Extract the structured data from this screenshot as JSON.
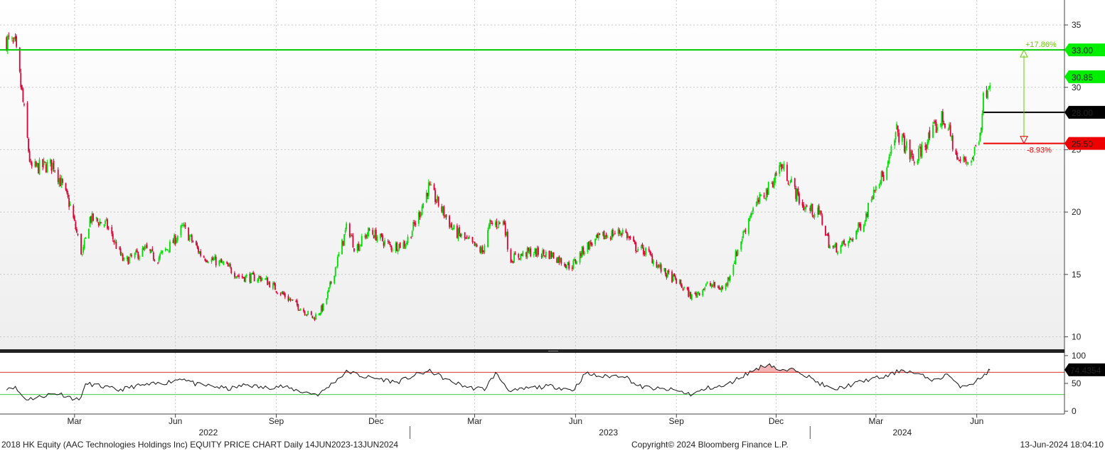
{
  "chart_data": [
    {
      "type": "candlestick",
      "ylim": [
        9,
        37
      ],
      "yticks": [
        10,
        15,
        20,
        25,
        30,
        35
      ],
      "grid": true,
      "up_color": "#00dd00",
      "down_color": "#dd0033",
      "price_path": [
        [
          "2021-12-29",
          33.8
        ],
        [
          "2022-01-06",
          33.2
        ],
        [
          "2022-01-12",
          29.5
        ],
        [
          "2022-01-20",
          23.5
        ],
        [
          "2022-02-10",
          23.8
        ],
        [
          "2022-02-25",
          20.5
        ],
        [
          "2022-03-08",
          16.5
        ],
        [
          "2022-03-15",
          19.5
        ],
        [
          "2022-03-30",
          19.0
        ],
        [
          "2022-04-15",
          16.0
        ],
        [
          "2022-05-05",
          17.0
        ],
        [
          "2022-05-15",
          16.2
        ],
        [
          "2022-05-30",
          17.6
        ],
        [
          "2022-06-08",
          18.8
        ],
        [
          "2022-06-25",
          16.5
        ],
        [
          "2022-07-15",
          15.8
        ],
        [
          "2022-07-30",
          14.8
        ],
        [
          "2022-08-20",
          14.7
        ],
        [
          "2022-09-10",
          13.2
        ],
        [
          "2022-10-05",
          11.5
        ],
        [
          "2022-10-15",
          12.5
        ],
        [
          "2022-10-28",
          16.5
        ],
        [
          "2022-11-05",
          19.0
        ],
        [
          "2022-11-12",
          17.0
        ],
        [
          "2022-11-25",
          18.5
        ],
        [
          "2022-12-15",
          17.2
        ],
        [
          "2022-12-28",
          17.5
        ],
        [
          "2023-01-08",
          19.5
        ],
        [
          "2023-01-18",
          22.0
        ],
        [
          "2023-01-28",
          20.5
        ],
        [
          "2023-02-10",
          18.5
        ],
        [
          "2023-02-25",
          17.5
        ],
        [
          "2023-03-08",
          16.8
        ],
        [
          "2023-03-15",
          19.0
        ],
        [
          "2023-03-28",
          19.2
        ],
        [
          "2023-04-02",
          16.2
        ],
        [
          "2023-04-20",
          16.8
        ],
        [
          "2023-05-10",
          16.6
        ],
        [
          "2023-05-28",
          15.6
        ],
        [
          "2023-06-10",
          17.2
        ],
        [
          "2023-06-25",
          18.0
        ],
        [
          "2023-07-15",
          18.5
        ],
        [
          "2023-07-25",
          17.2
        ],
        [
          "2023-08-05",
          16.8
        ],
        [
          "2023-08-20",
          15.2
        ],
        [
          "2023-09-01",
          14.5
        ],
        [
          "2023-09-15",
          13.2
        ],
        [
          "2023-09-30",
          14.2
        ],
        [
          "2023-10-15",
          13.8
        ],
        [
          "2023-10-25",
          16.5
        ],
        [
          "2023-11-08",
          20.0
        ],
        [
          "2023-11-25",
          22.0
        ],
        [
          "2023-12-05",
          23.8
        ],
        [
          "2023-12-12",
          22.8
        ],
        [
          "2023-12-25",
          20.5
        ],
        [
          "2024-01-10",
          19.8
        ],
        [
          "2024-01-20",
          17.0
        ],
        [
          "2024-02-05",
          17.5
        ],
        [
          "2024-02-20",
          19.5
        ],
        [
          "2024-03-01",
          22.5
        ],
        [
          "2024-03-10",
          23.0
        ],
        [
          "2024-03-20",
          26.5
        ],
        [
          "2024-04-05",
          24.0
        ],
        [
          "2024-04-15",
          25.5
        ],
        [
          "2024-04-30",
          27.5
        ],
        [
          "2024-05-05",
          27.0
        ],
        [
          "2024-05-15",
          24.0
        ],
        [
          "2024-05-28",
          24.3
        ],
        [
          "2024-06-04",
          26.5
        ],
        [
          "2024-06-07",
          29.0
        ],
        [
          "2024-06-13",
          30.85
        ]
      ],
      "hlines": [
        {
          "label": "33.00",
          "value": 33.0,
          "color": "#00cc00",
          "from": "start"
        },
        {
          "label": "28.00",
          "value": 28.0,
          "color": "#000000",
          "from": "2024-06-07"
        },
        {
          "label": "25.50",
          "value": 25.5,
          "color": "#ee0000",
          "from": "2024-06-07"
        }
      ],
      "last_price": {
        "label": "30.85",
        "value": 30.85,
        "color": "#00ee00"
      },
      "annotations": [
        {
          "text": "+17.86%",
          "color": "#66cc00",
          "value": 33.0
        },
        {
          "text": "-8.93%",
          "color": "#ee0000",
          "value": 25.5
        }
      ]
    },
    {
      "type": "line",
      "ylim": [
        -5,
        105
      ],
      "yticks": [
        0,
        50,
        100
      ],
      "levels": [
        70,
        30
      ],
      "last_value": {
        "label": "74.4354",
        "value": 74.4354
      },
      "path": [
        [
          "2021-12-29",
          42
        ],
        [
          "2022-01-05",
          44
        ],
        [
          "2022-01-15",
          22
        ],
        [
          "2022-01-25",
          24
        ],
        [
          "2022-02-05",
          30
        ],
        [
          "2022-02-15",
          32
        ],
        [
          "2022-02-25",
          25
        ],
        [
          "2022-03-05",
          20
        ],
        [
          "2022-03-12",
          50
        ],
        [
          "2022-03-25",
          45
        ],
        [
          "2022-04-10",
          38
        ],
        [
          "2022-04-25",
          45
        ],
        [
          "2022-05-10",
          48
        ],
        [
          "2022-05-25",
          52
        ],
        [
          "2022-06-08",
          60
        ],
        [
          "2022-06-20",
          48
        ],
        [
          "2022-07-05",
          45
        ],
        [
          "2022-07-20",
          40
        ],
        [
          "2022-08-05",
          48
        ],
        [
          "2022-08-20",
          42
        ],
        [
          "2022-09-05",
          45
        ],
        [
          "2022-09-25",
          35
        ],
        [
          "2022-10-10",
          30
        ],
        [
          "2022-10-25",
          55
        ],
        [
          "2022-11-05",
          72
        ],
        [
          "2022-11-20",
          62
        ],
        [
          "2022-12-05",
          58
        ],
        [
          "2022-12-20",
          52
        ],
        [
          "2023-01-10",
          68
        ],
        [
          "2023-01-20",
          72
        ],
        [
          "2023-02-05",
          55
        ],
        [
          "2023-02-25",
          42
        ],
        [
          "2023-03-10",
          40
        ],
        [
          "2023-03-20",
          68
        ],
        [
          "2023-04-03",
          35
        ],
        [
          "2023-04-20",
          42
        ],
        [
          "2023-05-10",
          45
        ],
        [
          "2023-05-30",
          38
        ],
        [
          "2023-06-10",
          68
        ],
        [
          "2023-06-25",
          62
        ],
        [
          "2023-07-15",
          65
        ],
        [
          "2023-07-28",
          45
        ],
        [
          "2023-08-15",
          40
        ],
        [
          "2023-08-30",
          38
        ],
        [
          "2023-09-15",
          30
        ],
        [
          "2023-09-30",
          42
        ],
        [
          "2023-10-15",
          45
        ],
        [
          "2023-10-30",
          62
        ],
        [
          "2023-11-15",
          78
        ],
        [
          "2023-11-25",
          85
        ],
        [
          "2023-12-05",
          72
        ],
        [
          "2023-12-20",
          75
        ],
        [
          "2024-01-05",
          55
        ],
        [
          "2024-01-22",
          38
        ],
        [
          "2024-02-08",
          48
        ],
        [
          "2024-02-25",
          58
        ],
        [
          "2024-03-10",
          62
        ],
        [
          "2024-03-25",
          75
        ],
        [
          "2024-04-10",
          65
        ],
        [
          "2024-04-25",
          55
        ],
        [
          "2024-05-05",
          68
        ],
        [
          "2024-05-15",
          45
        ],
        [
          "2024-05-28",
          50
        ],
        [
          "2024-06-05",
          60
        ],
        [
          "2024-06-13",
          74.4354
        ]
      ]
    }
  ],
  "x_axis": {
    "months": [
      {
        "label": "Mar",
        "date": "2022-03-01"
      },
      {
        "label": "Jun",
        "date": "2022-06-01"
      },
      {
        "label": "Sep",
        "date": "2022-09-01"
      },
      {
        "label": "Dec",
        "date": "2022-12-01"
      },
      {
        "label": "Mar",
        "date": "2023-03-01"
      },
      {
        "label": "Jun",
        "date": "2023-06-01"
      },
      {
        "label": "Sep",
        "date": "2023-09-01"
      },
      {
        "label": "Dec",
        "date": "2023-12-01"
      },
      {
        "label": "Mar",
        "date": "2024-03-01"
      },
      {
        "label": "Jun",
        "date": "2024-06-01"
      }
    ],
    "years": [
      {
        "label": "2022",
        "date": "2022-07-01"
      },
      {
        "label": "2023",
        "date": "2023-07-01"
      },
      {
        "label": "2024",
        "date": "2024-03-25"
      }
    ],
    "year_separators": [
      "2023-01-01",
      "2024-01-01"
    ],
    "start": "2021-12-23",
    "end": "2024-08-20"
  },
  "footer": {
    "title": "2018 HK Equity (AAC Technologies Holdings Inc) EQUITY PRICE CHART  Daily 14JUN2023-13JUN2024",
    "copyright": "Copyright© 2024 Bloomberg Finance L.P.",
    "timestamp": "13-Jun-2024 18:04:10"
  }
}
